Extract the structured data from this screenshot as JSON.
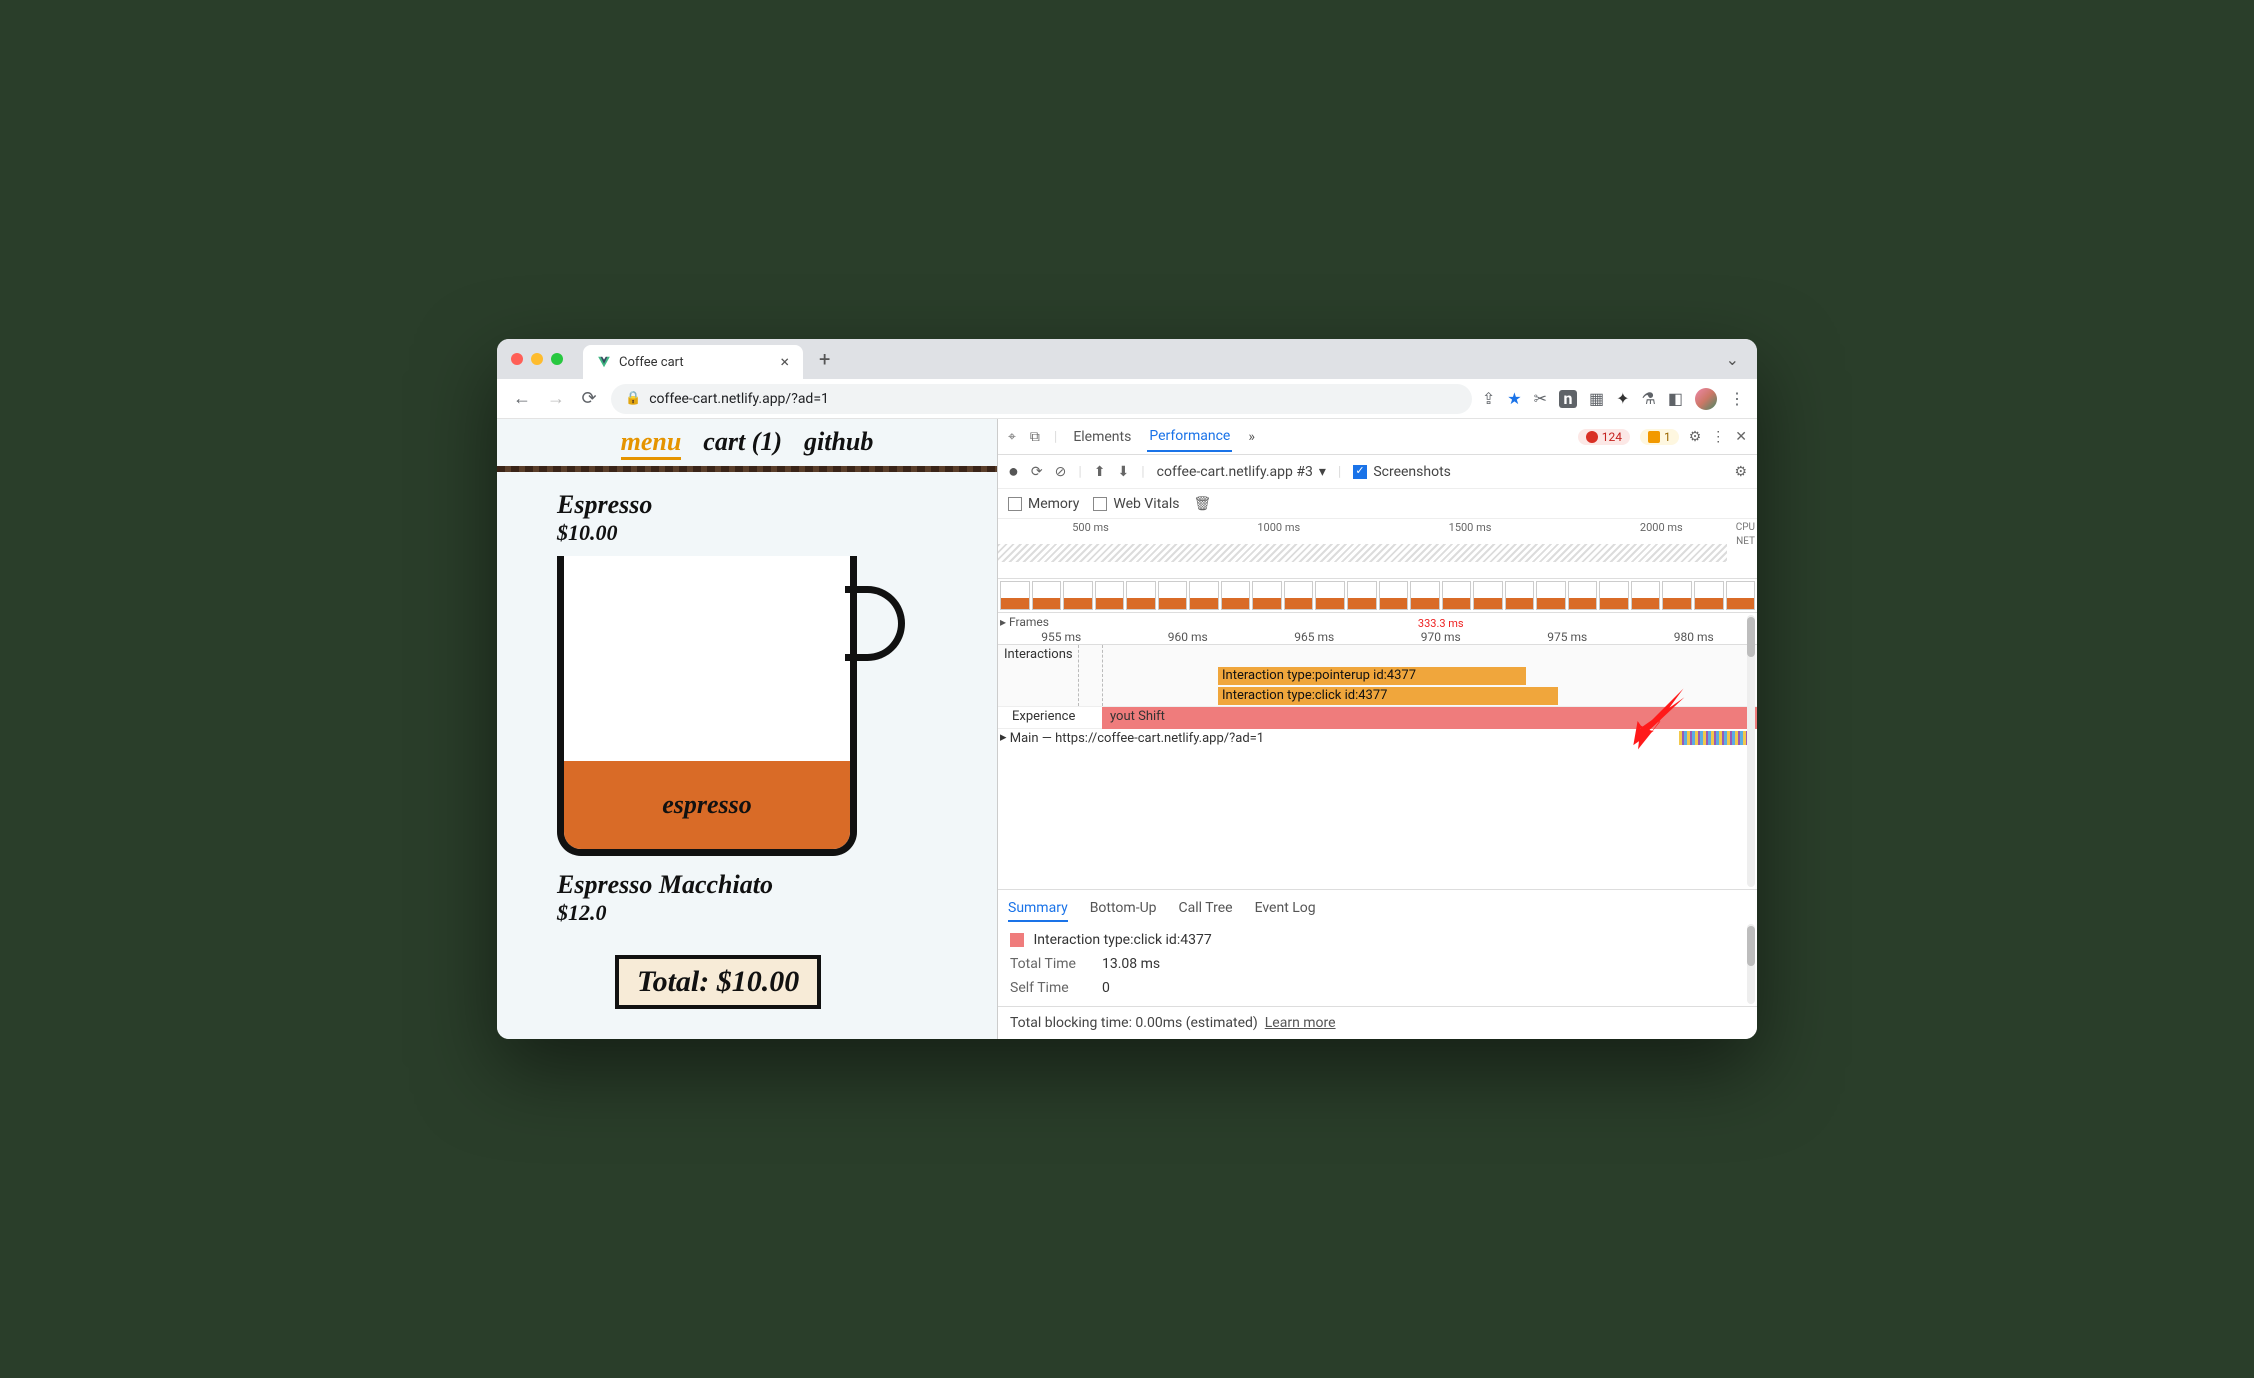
{
  "browser": {
    "tab_title": "Coffee cart",
    "url_display": "coffee-cart.netlify.app/?ad=1"
  },
  "page": {
    "nav": {
      "menu": "menu",
      "cart": "cart (1)",
      "github": "github"
    },
    "product1": {
      "name": "Espresso",
      "price": "$10.00",
      "fill_label": "espresso"
    },
    "product2": {
      "name": "Espresso Macchiato",
      "price": "$12.0"
    },
    "total_label": "Total: $10.00"
  },
  "devtools": {
    "tabs": {
      "elements": "Elements",
      "performance": "Performance",
      "more": "»"
    },
    "errors_badge": "124",
    "warnings_badge": "1",
    "perf": {
      "recording_select": "coffee-cart.netlify.app #3",
      "screenshots_label": "Screenshots",
      "opts": {
        "memory": "Memory",
        "webvitals": "Web Vitals"
      }
    },
    "overview_ticks": [
      "500 ms",
      "1000 ms",
      "1500 ms",
      "2000 ms"
    ],
    "overview_side": {
      "cpu": "CPU",
      "net": "NET"
    },
    "ruler": [
      "955 ms",
      "960 ms",
      "965 ms",
      "970 ms",
      "975 ms",
      "980 ms"
    ],
    "ruler_odd": "333.3 ms",
    "frames_label": "Frames",
    "interactions_label": "Interactions",
    "interaction1": "Interaction type:pointerup id:4377",
    "interaction2": "Interaction type:click id:4377",
    "experience_label": "Experience",
    "experience_event": "yout Shift",
    "main_label": "Main — https://coffee-cart.netlify.app/?ad=1",
    "summary_tabs": {
      "summary": "Summary",
      "bottomup": "Bottom-Up",
      "calltree": "Call Tree",
      "eventlog": "Event Log"
    },
    "summary": {
      "selected": "Interaction type:click id:4377",
      "total_time_k": "Total Time",
      "total_time_v": "13.08 ms",
      "self_time_k": "Self Time",
      "self_time_v": "0"
    },
    "footer": {
      "blocking": "Total blocking time: 0.00ms (estimated)",
      "learn": "Learn more"
    }
  }
}
